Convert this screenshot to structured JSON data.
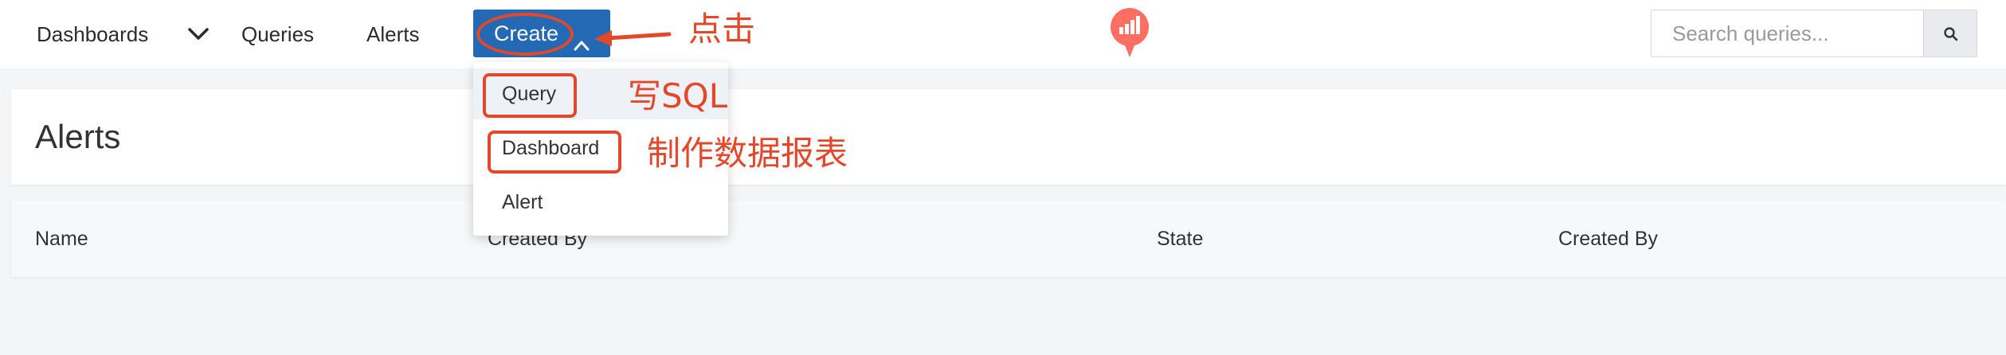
{
  "nav": {
    "dashboards": "Dashboards",
    "queries": "Queries",
    "alerts": "Alerts",
    "create": "Create"
  },
  "search": {
    "placeholder": "Search queries..."
  },
  "page": {
    "title": "Alerts"
  },
  "table": {
    "columns": [
      "Name",
      "Created By",
      "State",
      "Created By"
    ]
  },
  "create_menu": {
    "items": [
      "Query",
      "Dashboard",
      "Alert"
    ]
  },
  "annotations": {
    "click": "点击",
    "write_sql": "写SQL",
    "make_dashboard": "制作数据报表"
  },
  "colors": {
    "accent": "#2469b3",
    "annotation": "#e4482a",
    "logo": "#ff6f61"
  },
  "icons": {
    "dashboards_dropdown": "chevron-down-icon",
    "create_caret": "chevron-up-icon",
    "brand": "redash-logo",
    "search": "search-icon"
  }
}
